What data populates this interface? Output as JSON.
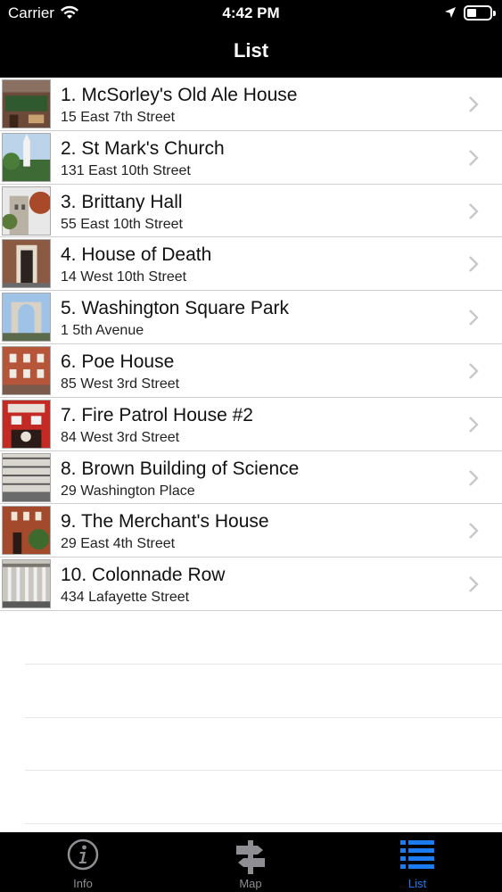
{
  "status_bar": {
    "carrier": "Carrier",
    "time": "4:42 PM"
  },
  "nav": {
    "title": "List"
  },
  "items": [
    {
      "title": "1. McSorley's Old Ale House",
      "address": "15 East 7th Street"
    },
    {
      "title": "2. St Mark's Church",
      "address": "131 East 10th Street"
    },
    {
      "title": "3. Brittany Hall",
      "address": "55 East 10th Street"
    },
    {
      "title": "4. House of Death",
      "address": "14 West 10th Street"
    },
    {
      "title": "5. Washington Square Park",
      "address": "1 5th Avenue"
    },
    {
      "title": "6. Poe House",
      "address": "85 West 3rd Street"
    },
    {
      "title": "7. Fire Patrol House #2",
      "address": "84 West 3rd Street"
    },
    {
      "title": "8. Brown Building of Science",
      "address": "29 Washington Place"
    },
    {
      "title": "9. The Merchant's House",
      "address": "29 East 4th Street"
    },
    {
      "title": "10. Colonnade Row",
      "address": "434 Lafayette Street"
    }
  ],
  "tabbar": {
    "info_label": "Info",
    "map_label": "Map",
    "list_label": "List",
    "active": "List",
    "active_color": "#1a7cf0",
    "inactive_color": "#8e8e93"
  }
}
